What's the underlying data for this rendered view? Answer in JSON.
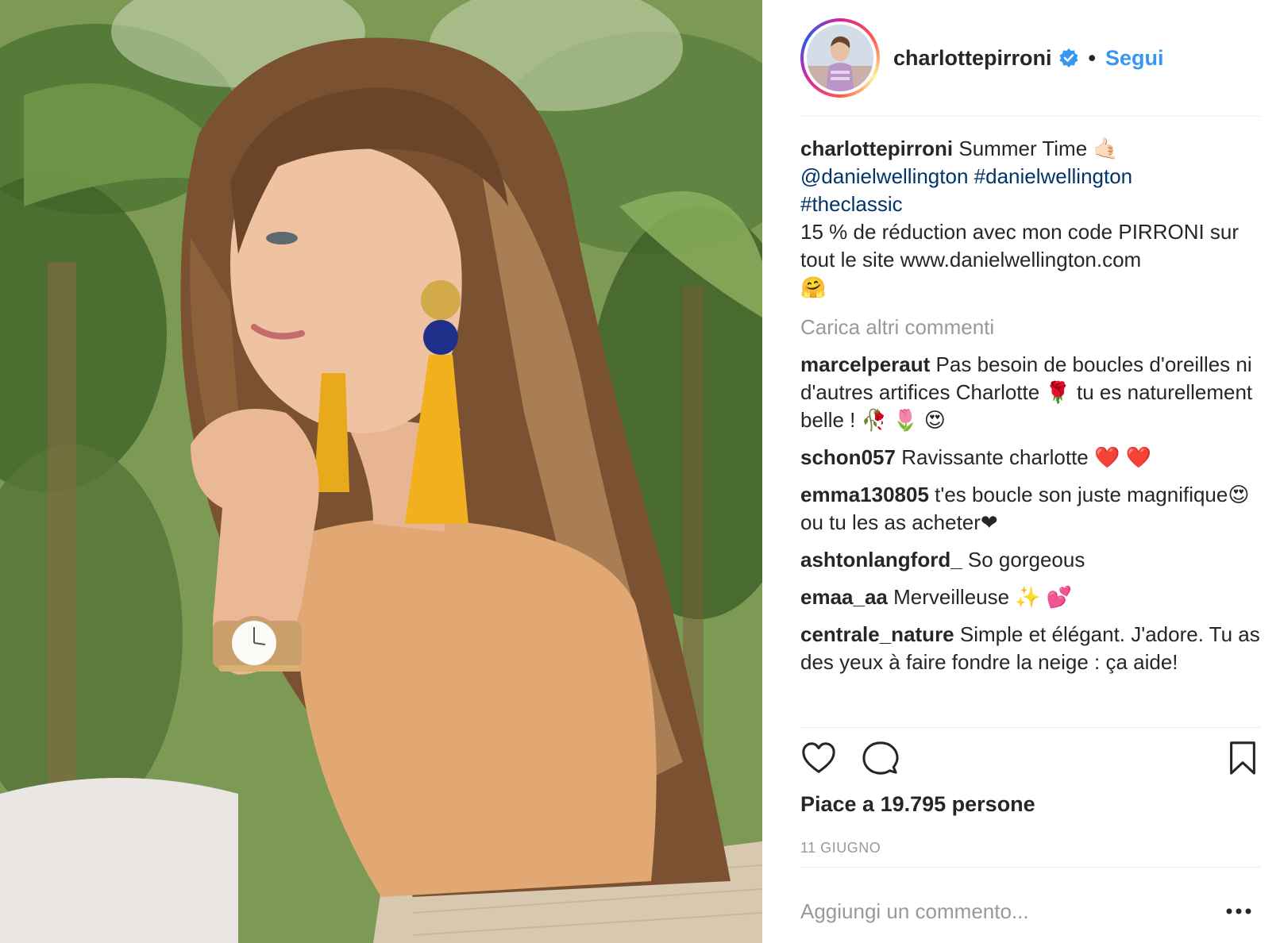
{
  "header": {
    "username": "charlottepirroni",
    "separator": "•",
    "follow_label": "Segui"
  },
  "caption": {
    "user": "charlottepirroni",
    "text": "Summer Time 🤙🏻",
    "mention": "@danielwellington",
    "hashtag1": "#danielwellington",
    "hashtag2": "#theclassic",
    "line_discount": "15 % de réduction avec mon code PIRRONI sur tout le site www.danielwellington.com",
    "emoji": "🤗"
  },
  "load_more_label": "Carica altri commenti",
  "comments": [
    {
      "user": "marcelperaut",
      "text": "Pas besoin de boucles d'oreilles ni d'autres artifices Charlotte 🌹 tu es naturellement belle ! 🥀 🌷 😍"
    },
    {
      "user": "schon057",
      "text": "Ravissante charlotte ❤️ ❤️"
    },
    {
      "user": "emma130805",
      "text": "t'es boucle son juste magnifique😍 ou tu les as acheter❤"
    },
    {
      "user": "ashtonlangford_",
      "text": "So gorgeous"
    },
    {
      "user": "emaa_aa",
      "text": "Merveilleuse ✨ 💕"
    },
    {
      "user": "centrale_nature",
      "text": "Simple et élégant. J'adore. Tu as des yeux à faire fondre la neige : ça aide!"
    }
  ],
  "actions": {
    "like_icon": "heart-icon",
    "comment_icon": "comment-bubble-icon",
    "save_icon": "bookmark-icon"
  },
  "likes_label": "Piace a 19.795 persone",
  "date_label": "11 GIUGNO",
  "add_comment_placeholder": "Aggiungi un commento...",
  "colors": {
    "link": "#003569",
    "follow": "#3897f0",
    "muted": "#999999",
    "text": "#262626"
  }
}
